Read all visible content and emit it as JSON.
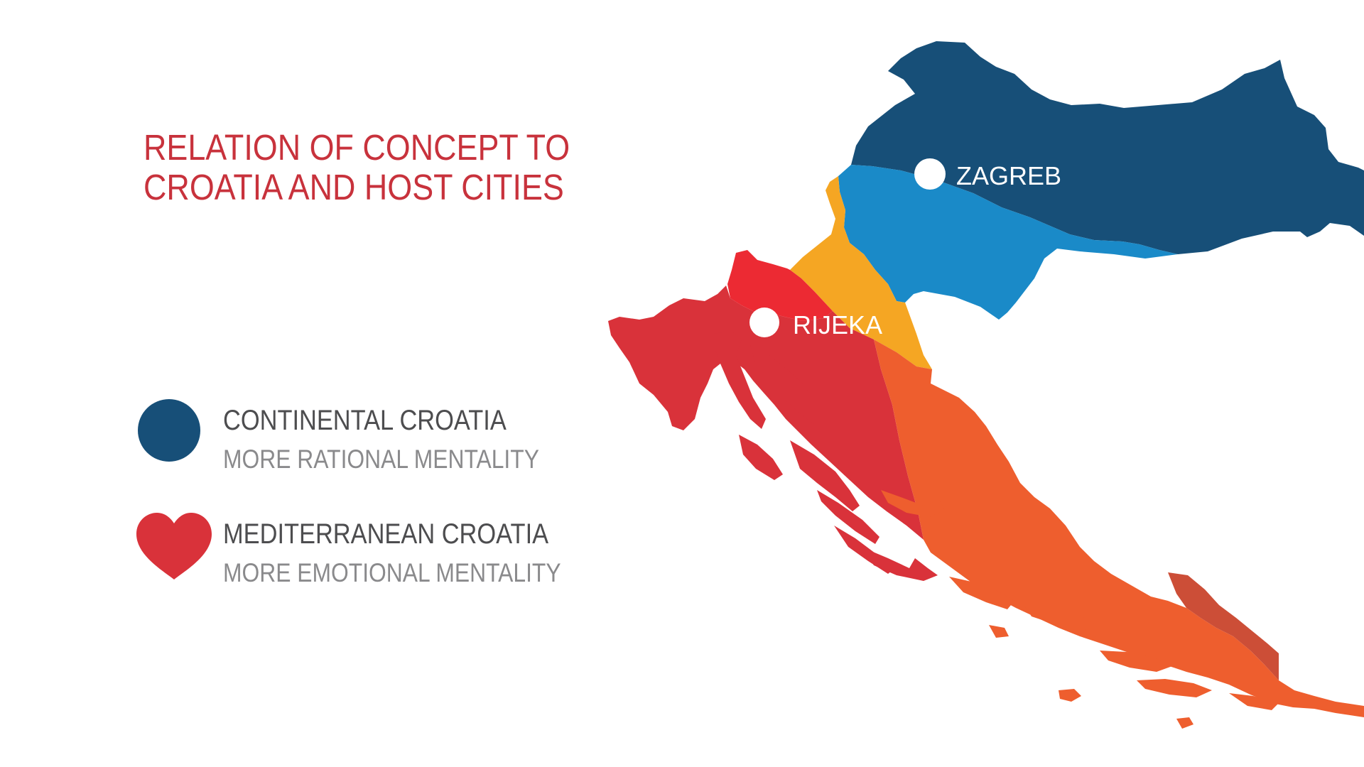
{
  "title": {
    "line1": "RELATION OF CONCEPT TO",
    "line2": "CROATIA AND HOST CITIES"
  },
  "legend": {
    "continental": {
      "heading": "CONTINENTAL CROATIA",
      "subtitle": "MORE RATIONAL MENTALITY",
      "symbol": "circle-icon",
      "color": "#174f78"
    },
    "mediterranean": {
      "heading": "MEDITERRANEAN CROATIA",
      "subtitle": "MORE EMOTIONAL MENTALITY",
      "symbol": "heart-icon",
      "color": "#d9323a"
    }
  },
  "map": {
    "cities": {
      "zagreb": "ZAGREB",
      "rijeka": "RIJEKA"
    },
    "region_colors": {
      "north_dark_blue": "#174f78",
      "central_light_blue": "#1a8ac8",
      "band_yellow": "#f5a623",
      "coast_red": "#d9323a",
      "bright_red": "#ec2a33",
      "dalmatia_orange": "#ee5e2e",
      "south_brick": "#cc4e37"
    }
  }
}
